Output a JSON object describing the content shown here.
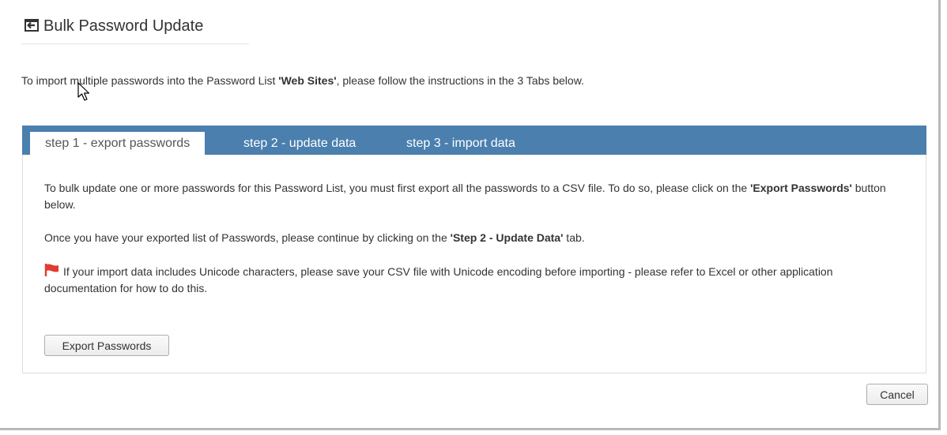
{
  "header": {
    "title": "Bulk Password Update",
    "icon": "import-icon"
  },
  "intro": {
    "prefix": "To import multiple passwords into the Password List ",
    "list_name": "'Web Sites'",
    "suffix": ", please follow the instructions in the 3 Tabs below."
  },
  "tabs": [
    {
      "label": "step 1 - export passwords",
      "active": true
    },
    {
      "label": "step 2 - update data",
      "active": false
    },
    {
      "label": "step 3 - import data",
      "active": false
    }
  ],
  "step1": {
    "para1_text": "To bulk update one or more passwords for this Password List, you must first export all the passwords to a CSV file. To do so, please click on the ",
    "para1_bold": "'Export Passwords'",
    "para1_end": " button below.",
    "para2_text": "Once you have your exported list of Passwords, please continue by clicking on the ",
    "para2_bold": "'Step 2 - Update Data'",
    "para2_end": " tab.",
    "note": "If your import data includes Unicode characters, please save your CSV file with Unicode encoding before importing - please refer to Excel or other application documentation for how to do this.",
    "export_button": "Export Passwords"
  },
  "footer": {
    "cancel_button": "Cancel"
  },
  "colors": {
    "tabbar": "#4a7fae",
    "flag": "#e03c31"
  }
}
